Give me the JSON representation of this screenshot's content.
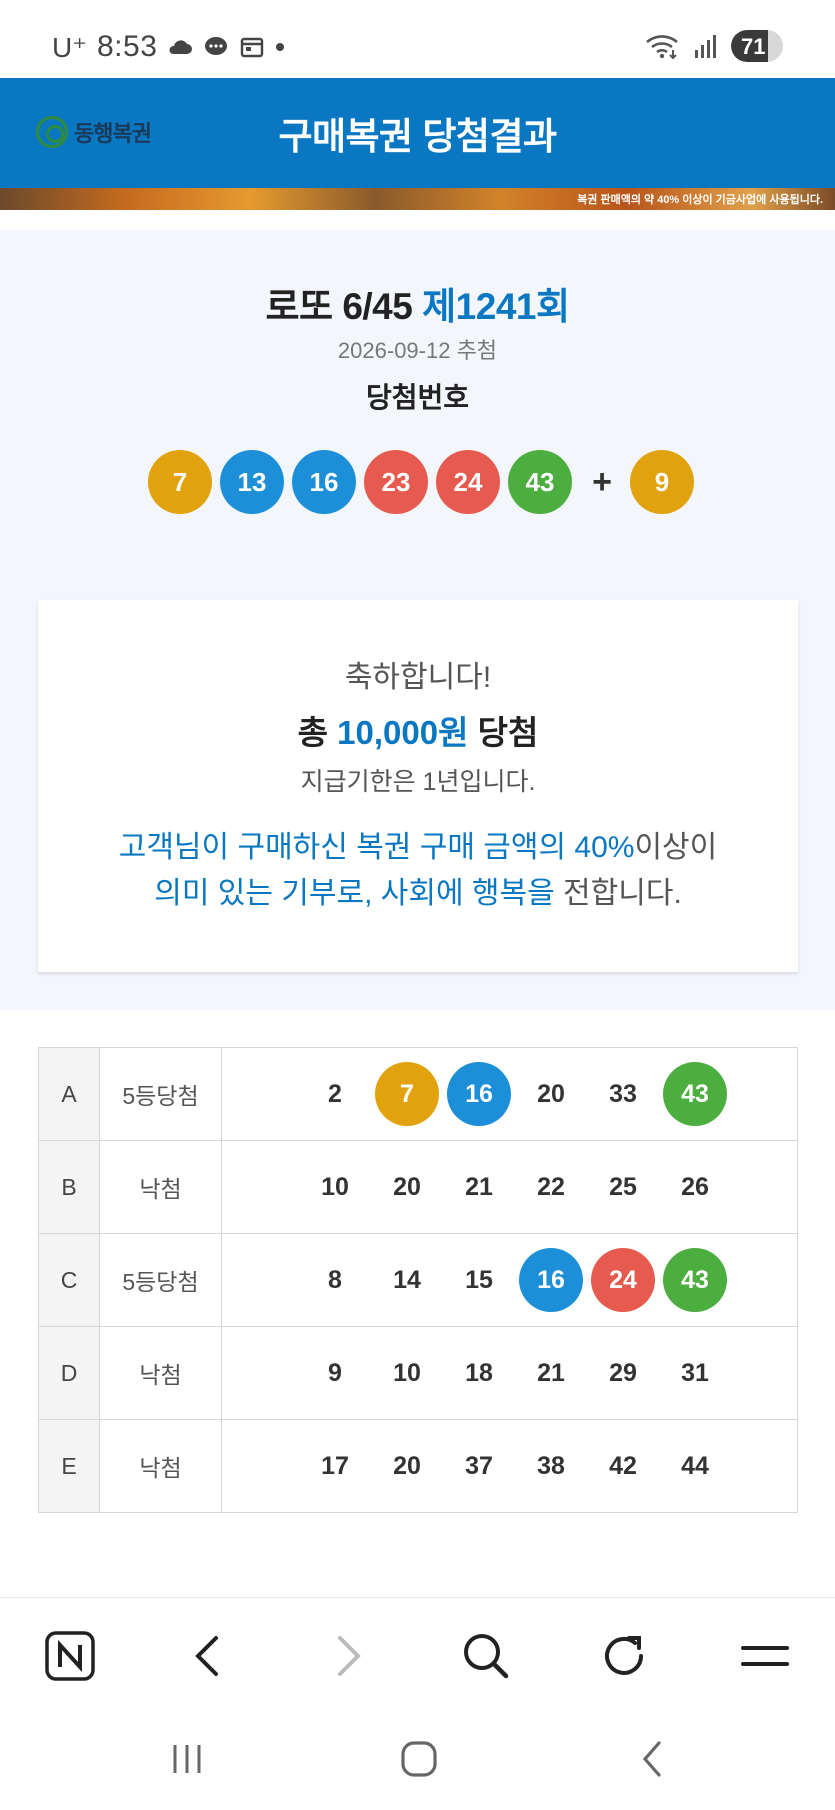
{
  "status_bar": {
    "carrier": "U⁺",
    "time": "8:53",
    "battery": "71",
    "battery_level": 0.71
  },
  "header": {
    "logo_text": "동행복권",
    "title": "구매복권 당첨결과"
  },
  "banner": {
    "text": "복권 판매액의 약 40% 이상이 기금사업에 사용됩니다."
  },
  "draw": {
    "game_name": "로또 6/45",
    "round": "제1241회",
    "date": "2026-09-12 추첨",
    "winning_label": "당첨번호",
    "numbers": [
      {
        "value": "7",
        "color": "#e2a20d"
      },
      {
        "value": "13",
        "color": "#1c8fd8"
      },
      {
        "value": "16",
        "color": "#1c8fd8"
      },
      {
        "value": "23",
        "color": "#e65a4f"
      },
      {
        "value": "24",
        "color": "#e65a4f"
      },
      {
        "value": "43",
        "color": "#4cae3f"
      }
    ],
    "plus": "+",
    "bonus": {
      "value": "9",
      "color": "#e2a20d"
    }
  },
  "prize": {
    "congrats": "축하합니다!",
    "total_prefix": "총",
    "total_amount": "10,000원",
    "total_suffix": "당첨",
    "deadline": "지급기한은 1년입니다.",
    "donation_part1": "고객님이 구매하신 복권 구매 금액의 40%",
    "donation_part2": "이상이",
    "donation_part3": "의미 있는 기부로, 사회에 행복을",
    "donation_part4": " 전합니다."
  },
  "tickets": [
    {
      "game": "A",
      "rank": "5등당첨",
      "numbers": [
        {
          "value": "2",
          "hit": false
        },
        {
          "value": "7",
          "hit": true,
          "color": "#e2a20d"
        },
        {
          "value": "16",
          "hit": true,
          "color": "#1c8fd8"
        },
        {
          "value": "20",
          "hit": false
        },
        {
          "value": "33",
          "hit": false
        },
        {
          "value": "43",
          "hit": true,
          "color": "#4cae3f"
        }
      ]
    },
    {
      "game": "B",
      "rank": "낙첨",
      "numbers": [
        {
          "value": "10",
          "hit": false
        },
        {
          "value": "20",
          "hit": false
        },
        {
          "value": "21",
          "hit": false
        },
        {
          "value": "22",
          "hit": false
        },
        {
          "value": "25",
          "hit": false
        },
        {
          "value": "26",
          "hit": false
        }
      ]
    },
    {
      "game": "C",
      "rank": "5등당첨",
      "numbers": [
        {
          "value": "8",
          "hit": false
        },
        {
          "value": "14",
          "hit": false
        },
        {
          "value": "15",
          "hit": false
        },
        {
          "value": "16",
          "hit": true,
          "color": "#1c8fd8"
        },
        {
          "value": "24",
          "hit": true,
          "color": "#e65a4f"
        },
        {
          "value": "43",
          "hit": true,
          "color": "#4cae3f"
        }
      ]
    },
    {
      "game": "D",
      "rank": "낙첨",
      "numbers": [
        {
          "value": "9",
          "hit": false
        },
        {
          "value": "10",
          "hit": false
        },
        {
          "value": "18",
          "hit": false
        },
        {
          "value": "21",
          "hit": false
        },
        {
          "value": "29",
          "hit": false
        },
        {
          "value": "31",
          "hit": false
        }
      ]
    },
    {
      "game": "E",
      "rank": "낙첨",
      "numbers": [
        {
          "value": "17",
          "hit": false
        },
        {
          "value": "20",
          "hit": false
        },
        {
          "value": "37",
          "hit": false
        },
        {
          "value": "38",
          "hit": false
        },
        {
          "value": "42",
          "hit": false
        },
        {
          "value": "44",
          "hit": false
        }
      ]
    }
  ],
  "toolbar": {
    "icons": [
      "naver-n-icon",
      "back-arrow-icon",
      "forward-arrow-icon",
      "search-icon",
      "refresh-icon",
      "menu-icon"
    ]
  },
  "navbar": {
    "icons": [
      "recent-apps-icon",
      "home-icon",
      "back-icon"
    ]
  }
}
